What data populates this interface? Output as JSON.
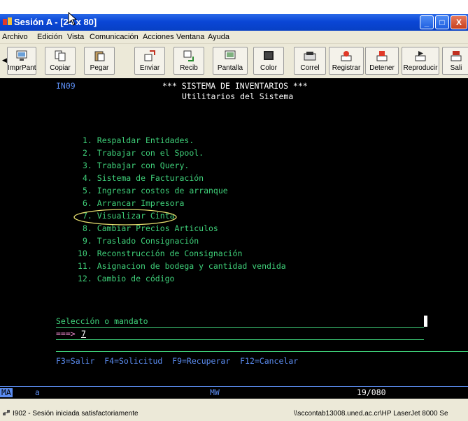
{
  "window": {
    "title": "Sesión A - [24 x 80]",
    "controls": [
      "_",
      "□",
      "X"
    ]
  },
  "menu": [
    "Archivo",
    "Edición",
    "Vista",
    "Comunicación",
    "Acciones",
    "Ventana",
    "Ayuda"
  ],
  "toolbar": {
    "buttons": [
      {
        "label": "ImprPant",
        "icon": "print-screen-icon"
      },
      {
        "label": "Copiar",
        "icon": "copy-icon"
      },
      {
        "label": "Pegar",
        "icon": "paste-icon"
      },
      {
        "label": "Enviar",
        "icon": "send-icon"
      },
      {
        "label": "Recib",
        "icon": "receive-icon"
      },
      {
        "label": "Pantalla",
        "icon": "display-icon"
      },
      {
        "label": "Color",
        "icon": "color-icon"
      },
      {
        "label": "Correl",
        "icon": "keyboard-map-icon"
      },
      {
        "label": "Registrar",
        "icon": "record-icon"
      },
      {
        "label": "Detener",
        "icon": "stop-icon"
      },
      {
        "label": "Reproducir",
        "icon": "play-icon"
      },
      {
        "label": "Sali",
        "icon": "exit-icon"
      }
    ]
  },
  "screen": {
    "program_id": "IN09",
    "title": "*** SISTEMA DE INVENTARIOS ***",
    "subtitle": "Utilitarios del Sistema",
    "menu_items": [
      "1. Respaldar Entidades.",
      "2. Trabajar con el Spool.",
      "3. Trabajar con Query.",
      "4. Sistema de Facturación",
      "5. Ingresar costos de arranque",
      "6. Arrancar Impresora",
      "7. Visualizar Cinta",
      "8. Cambiar Precios Articulos",
      "9. Traslado Consignación",
      "10. Reconstrucción de Consignación",
      "11. Asignacion de bodega y cantidad vendida",
      "12. Cambio de código"
    ],
    "selection_label": "Selección o mandato",
    "prompt": "===>",
    "input_value": "7",
    "function_keys": "F3=Salir  F4=Solicitud  F9=Recuperar  F12=Cancelar"
  },
  "oia": {
    "left": "MA",
    "mode": "a",
    "mw": "MW",
    "cursor_position": "19/080"
  },
  "status": {
    "message": "I902 - Sesión iniciada satisfactoriamente",
    "printer": "\\\\sccontab13008.uned.ac.cr\\HP LaserJet 8000 Se"
  },
  "colors": {
    "terminal_bg": "#000000",
    "title_color": "#ffffff",
    "menu_color": "#3fd17a",
    "program_color": "#5b8cf0",
    "highlight_ellipse": "#e8e070"
  }
}
